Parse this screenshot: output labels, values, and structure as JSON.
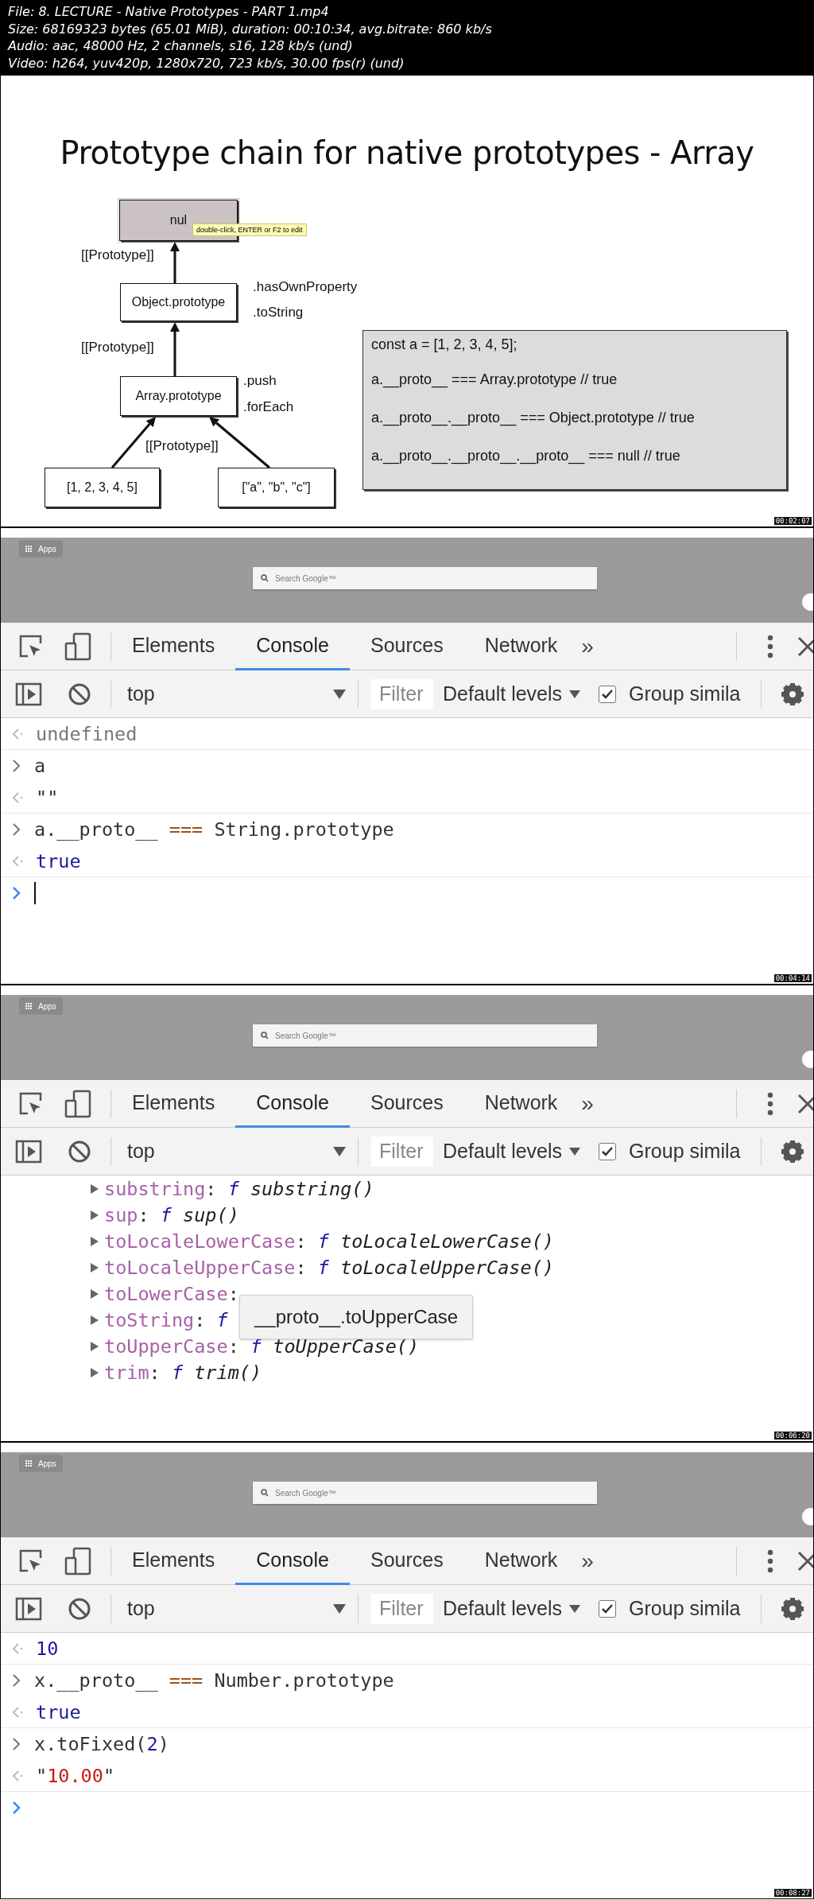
{
  "file_info": [
    "File: 8. LECTURE - Native Prototypes - PART 1.mp4",
    "Size: 68169323 bytes (65.01 MiB), duration: 00:10:34, avg.bitrate: 860 kb/s",
    "Audio: aac, 48000 Hz, 2 channels, s16, 128 kb/s (und)",
    "Video: h264, yuv420p, 1280x720, 723 kb/s, 30.00 fps(r) (und)"
  ],
  "frames": [
    {
      "kind": "slide",
      "timestamp": "00:02:07",
      "title": "Prototype chain for native prototypes - Array",
      "nodes": [
        {
          "label": "nul",
          "selected": true
        },
        {
          "label": "Object.prototype",
          "selected": false
        },
        {
          "label": "Array.prototype",
          "selected": false
        },
        {
          "label": "[1, 2, 3, 4, 5]",
          "selected": false
        },
        {
          "label": "[\"a\", \"b\", \"c\"]",
          "selected": false
        }
      ],
      "edge_labels": [
        "[[Prototype]]",
        "[[Prototype]]",
        "[[Prototype]]"
      ],
      "methods": [
        ".hasOwnProperty",
        ".toString",
        ".push",
        ".forEach"
      ],
      "tooltip": "double-click, ENTER or F2 to edit",
      "code_lines": [
        "const a = [1, 2, 3, 4, 5];",
        "a.__proto__ === Array.prototype // true",
        "a.__proto__.__proto__ === Object.prototype // true",
        "a.__proto__.__proto__.__proto__ === null // true"
      ]
    },
    {
      "kind": "devtools",
      "timestamp": "00:04:14",
      "bookmark": "Apps",
      "search": {
        "placeholder": "Search Google™"
      },
      "tabs": [
        {
          "label": "Elements",
          "selected": false
        },
        {
          "label": "Console",
          "selected": true
        },
        {
          "label": "Sources",
          "selected": false
        },
        {
          "label": "Network",
          "selected": false
        }
      ],
      "more": "»",
      "context": "top",
      "filter": {
        "placeholder": "Filter"
      },
      "levels": "Default levels",
      "group_similar": {
        "label": "Group simila",
        "checked": true
      },
      "console": [
        {
          "kind": "result",
          "tokens": [
            {
              "text": "undefined",
              "kind": "undefined"
            }
          ]
        },
        {
          "kind": "input",
          "tokens": [
            {
              "text": "a",
              "kind": "plain"
            }
          ]
        },
        {
          "kind": "result",
          "tokens": [
            {
              "text": "\"\"",
              "kind": "plain"
            }
          ]
        },
        {
          "kind": "input",
          "tokens": [
            {
              "text": "a.__proto__ ",
              "kind": "plain"
            },
            {
              "text": "===",
              "kind": "operator"
            },
            {
              "text": " String.prototype",
              "kind": "plain"
            }
          ]
        },
        {
          "kind": "result",
          "tokens": [
            {
              "text": "true",
              "kind": "bool"
            }
          ]
        },
        {
          "kind": "prompt",
          "caret": true
        }
      ]
    },
    {
      "kind": "devtools",
      "timestamp": "00:06:20",
      "bookmark": "Apps",
      "search": {
        "placeholder": "Search Google™"
      },
      "tabs": [
        {
          "label": "Elements",
          "selected": false
        },
        {
          "label": "Console",
          "selected": true
        },
        {
          "label": "Sources",
          "selected": false
        },
        {
          "label": "Network",
          "selected": false
        }
      ],
      "more": "»",
      "context": "top",
      "filter": {
        "placeholder": "Filter"
      },
      "levels": "Default levels",
      "group_similar": {
        "label": "Group simila",
        "checked": true
      },
      "console": [
        {
          "kind": "property",
          "tokens": [
            {
              "text": "substring",
              "kind": "name"
            },
            {
              "text": ": ",
              "kind": "plain"
            },
            {
              "text": "f",
              "kind": "keyword"
            },
            {
              "text": " substring()",
              "kind": "func"
            }
          ]
        },
        {
          "kind": "property",
          "tokens": [
            {
              "text": "sup",
              "kind": "name"
            },
            {
              "text": ": ",
              "kind": "plain"
            },
            {
              "text": "f",
              "kind": "keyword"
            },
            {
              "text": " sup()",
              "kind": "func"
            }
          ]
        },
        {
          "kind": "property",
          "tokens": [
            {
              "text": "toLocaleLowerCase",
              "kind": "name"
            },
            {
              "text": ": ",
              "kind": "plain"
            },
            {
              "text": "f",
              "kind": "keyword"
            },
            {
              "text": " toLocaleLowerCase()",
              "kind": "func"
            }
          ]
        },
        {
          "kind": "property",
          "tokens": [
            {
              "text": "toLocaleUpperCase",
              "kind": "name"
            },
            {
              "text": ": ",
              "kind": "plain"
            },
            {
              "text": "f",
              "kind": "keyword"
            },
            {
              "text": " toLocaleUpperCase()",
              "kind": "func"
            }
          ]
        },
        {
          "kind": "property",
          "tokens": [
            {
              "text": "toLowerCase",
              "kind": "name"
            },
            {
              "text": ":",
              "kind": "plain"
            }
          ]
        },
        {
          "kind": "property",
          "tokens": [
            {
              "text": "toString",
              "kind": "name"
            },
            {
              "text": ": ",
              "kind": "plain"
            },
            {
              "text": "f",
              "kind": "keyword"
            }
          ]
        },
        {
          "kind": "property",
          "tokens": [
            {
              "text": "toUpperCase",
              "kind": "name"
            },
            {
              "text": ": ",
              "kind": "plain"
            },
            {
              "text": "f",
              "kind": "keyword"
            },
            {
              "text": " toUpperCase()",
              "kind": "func"
            }
          ]
        },
        {
          "kind": "property",
          "tokens": [
            {
              "text": "trim",
              "kind": "name"
            },
            {
              "text": ": ",
              "kind": "plain"
            },
            {
              "text": "f",
              "kind": "keyword"
            },
            {
              "text": " trim()",
              "kind": "func"
            }
          ]
        }
      ],
      "autocomplete": "__proto__.toUpperCase"
    },
    {
      "kind": "devtools",
      "timestamp": "00:08:27",
      "bookmark": "Apps",
      "search": {
        "placeholder": "Search Google™"
      },
      "tabs": [
        {
          "label": "Elements",
          "selected": false
        },
        {
          "label": "Console",
          "selected": true
        },
        {
          "label": "Sources",
          "selected": false
        },
        {
          "label": "Network",
          "selected": false
        }
      ],
      "more": "»",
      "context": "top",
      "filter": {
        "placeholder": "Filter"
      },
      "levels": "Default levels",
      "group_similar": {
        "label": "Group simila",
        "checked": true
      },
      "console": [
        {
          "kind": "result",
          "tokens": [
            {
              "text": "10",
              "kind": "number"
            }
          ]
        },
        {
          "kind": "input",
          "tokens": [
            {
              "text": "x.__proto__ ",
              "kind": "plain"
            },
            {
              "text": "===",
              "kind": "operator"
            },
            {
              "text": " Number.prototype",
              "kind": "plain"
            }
          ]
        },
        {
          "kind": "result",
          "tokens": [
            {
              "text": "true",
              "kind": "bool"
            }
          ]
        },
        {
          "kind": "input",
          "tokens": [
            {
              "text": "x.toFixed(",
              "kind": "plain"
            },
            {
              "text": "2",
              "kind": "number"
            },
            {
              "text": ")",
              "kind": "plain"
            }
          ]
        },
        {
          "kind": "result",
          "tokens": [
            {
              "text": "\"",
              "kind": "plain"
            },
            {
              "text": "10.00",
              "kind": "string"
            },
            {
              "text": "\"",
              "kind": "plain"
            }
          ]
        },
        {
          "kind": "prompt",
          "caret": false
        }
      ]
    }
  ]
}
